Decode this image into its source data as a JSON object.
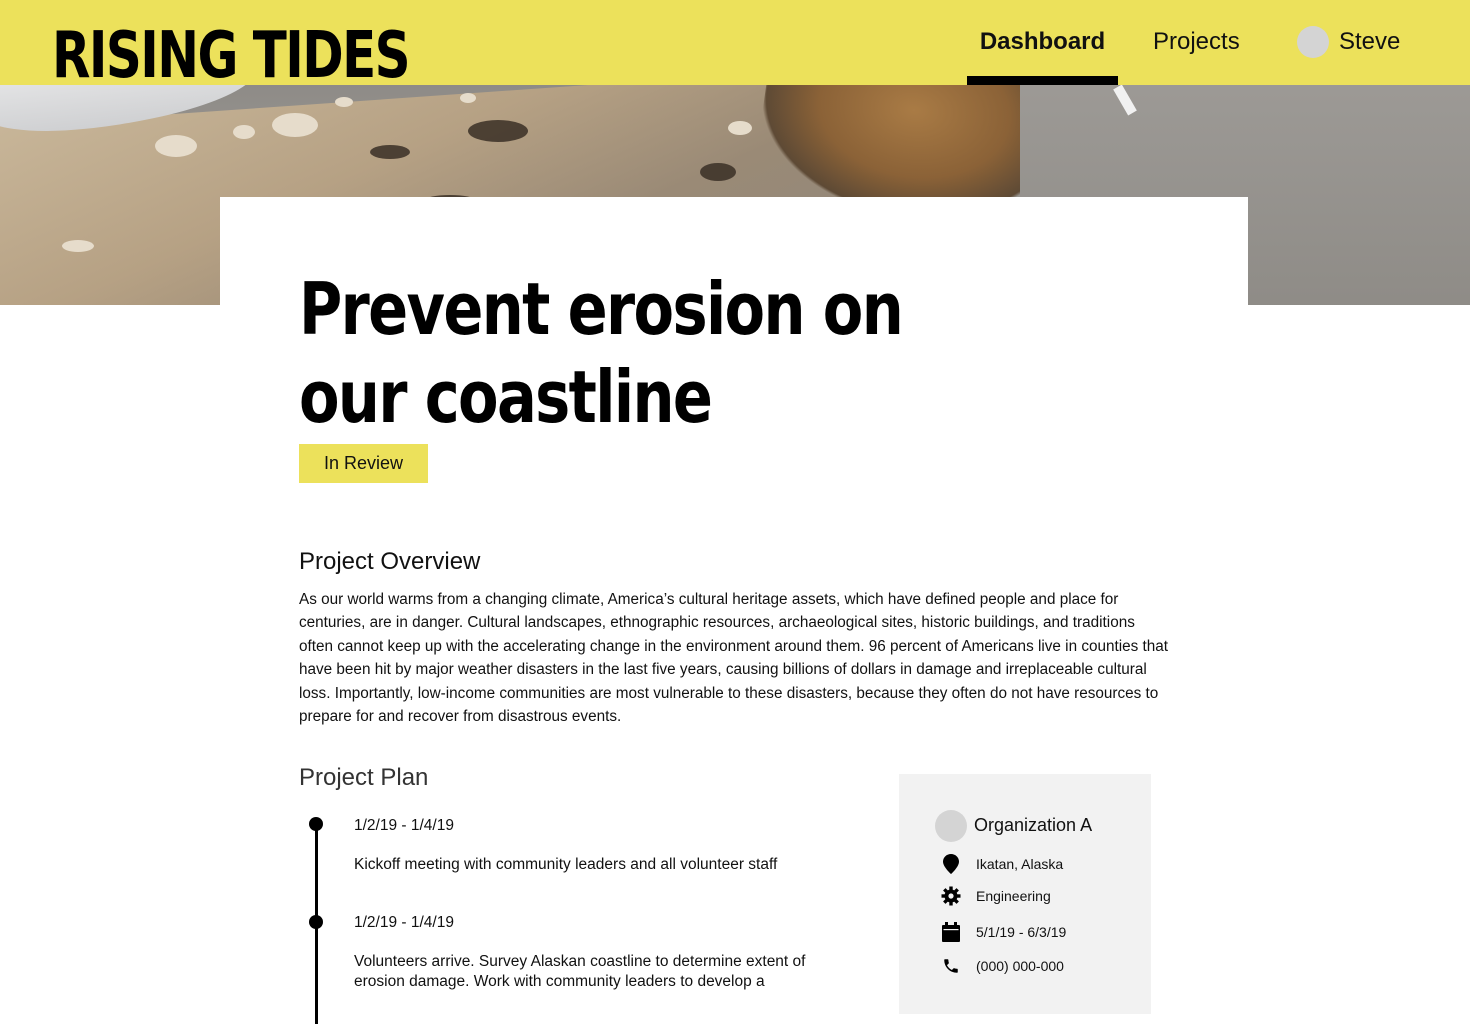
{
  "header": {
    "logo": "RISING TIDES",
    "nav": {
      "dashboard": "Dashboard",
      "projects": "Projects"
    },
    "user": {
      "name": "Steve"
    }
  },
  "project": {
    "title": "Prevent erosion on our coastline",
    "status": "In Review",
    "overview_heading": "Project Overview",
    "overview_text": "As our world warms from a changing climate, America’s cultural heritage assets, which have defined people and place for centuries, are in danger. Cultural landscapes, ethnographic resources, archaeological sites, historic buildings, and traditions often cannot keep up with the accelerating change in the environment around them. 96 percent of Americans live in counties that have been hit by major weather disasters in the last five years, causing billions of dollars in damage and irreplaceable cultural loss. Importantly, low-income communities are most vulnerable to these disasters, because they often do not have resources to prepare for and recover from disastrous events.",
    "plan_heading": "Project Plan",
    "plan": [
      {
        "date": "1/2/19 - 1/4/19",
        "description": "Kickoff meeting with community leaders and all volunteer staff"
      },
      {
        "date": "1/2/19 - 1/4/19",
        "description": "Volunteers arrive. Survey Alaskan coastline to determine extent of erosion damage. Work with community leaders to develop a"
      }
    ]
  },
  "organization": {
    "name": "Organization A",
    "location": "Ikatan, Alaska",
    "category": "Engineering",
    "dates": "5/1/19 - 6/3/19",
    "phone": "(000) 000-000"
  },
  "colors": {
    "accent": "#ece15b",
    "side_panel": "#f2f2f2",
    "avatar": "#d4d4d4"
  },
  "icons": [
    "location-pin-icon",
    "gear-icon",
    "calendar-icon",
    "phone-icon"
  ]
}
